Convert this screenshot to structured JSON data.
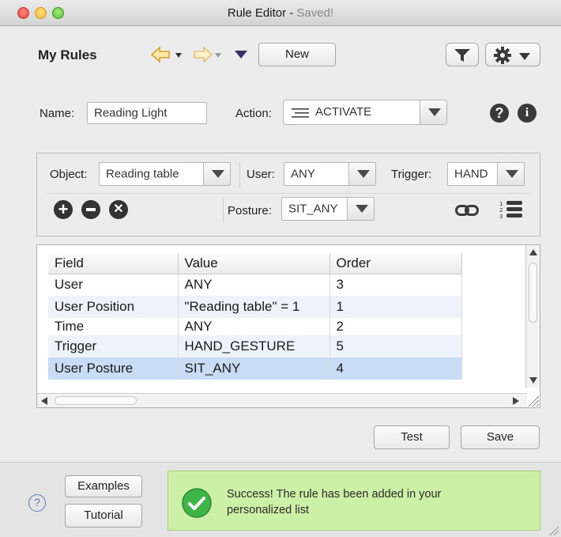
{
  "window": {
    "title": "Rule Editor - ",
    "status": "Saved!"
  },
  "header": {
    "title": "My Rules",
    "new_button": "New"
  },
  "rule": {
    "name_label": "Name:",
    "name_value": "Reading Light",
    "action_label": "Action:",
    "action_value": "ACTIVATE"
  },
  "criteria": {
    "object_label": "Object:",
    "object_value": "Reading table",
    "user_label": "User:",
    "user_value": "ANY",
    "trigger_label": "Trigger:",
    "trigger_value": "HAND",
    "posture_label": "Posture:",
    "posture_value": "SIT_ANY"
  },
  "table": {
    "columns": [
      "Field",
      "Value",
      "Order"
    ],
    "rows": [
      {
        "field": "User",
        "value": "ANY",
        "order": "3"
      },
      {
        "field": "User Position",
        "value": "\"Reading table\" = 1",
        "order": "1"
      },
      {
        "field": "Time",
        "value": "ANY",
        "order": "2"
      },
      {
        "field": "Trigger",
        "value": "HAND_GESTURE",
        "order": "5"
      },
      {
        "field": "User Posture",
        "value": "SIT_ANY",
        "order": "4"
      }
    ]
  },
  "actions": {
    "test": "Test",
    "save": "Save"
  },
  "footer": {
    "examples": "Examples",
    "tutorial": "Tutorial",
    "message": "Success! The rule has been added in your personalized list"
  },
  "colors": {
    "success_bg": "#cdf0a7",
    "selected_row": "#c9dcf5",
    "check_green": "#3fb549"
  }
}
